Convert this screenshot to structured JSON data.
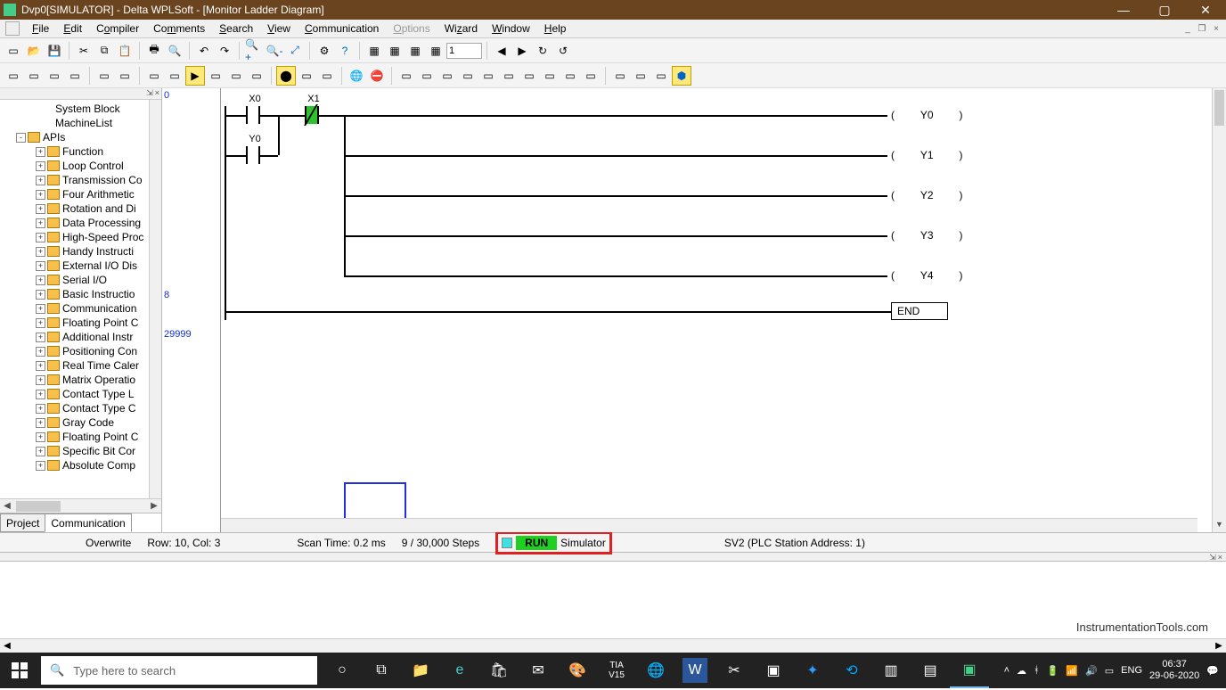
{
  "window": {
    "title": "Dvp0[SIMULATOR]  - Delta WPLSoft - [Monitor Ladder Diagram]",
    "btn_min": "—",
    "btn_max": "▢",
    "btn_close": "✕"
  },
  "menu": {
    "file": "File",
    "edit": "Edit",
    "compiler": "Compiler",
    "comments": "Comments",
    "search": "Search",
    "view": "View",
    "communication": "Communication",
    "options": "Options",
    "wizard": "Wizard",
    "window": "Window",
    "help": "Help"
  },
  "mdi": {
    "min": "_",
    "restore": "❐",
    "close": "×"
  },
  "toolbar1": {
    "field_value": "1"
  },
  "gutter": {
    "n0": "0",
    "n1": "8",
    "n2": "29999"
  },
  "ladder": {
    "c0": "X0",
    "c1": "X1",
    "c2": "Y0",
    "out0": "Y0",
    "out1": "Y1",
    "out2": "Y2",
    "out3": "Y3",
    "out4": "Y4",
    "end": "END"
  },
  "tree": {
    "system_block": "System Block",
    "machinelist": "MachineList",
    "apis": "APIs",
    "items": [
      "Function",
      "Loop Control",
      "Transmission Co",
      "Four Arithmetic",
      "Rotation and Di",
      "Data Processing",
      "High-Speed Proc",
      "Handy Instructi",
      "External I/O Dis",
      "Serial I/O",
      "Basic Instructio",
      "Communication",
      "Floating Point C",
      "Additional Instr",
      "Positioning Con",
      "Real Time Caler",
      "Matrix Operatio",
      "Contact Type L",
      "Contact Type C",
      "Gray Code",
      "Floating Point C",
      "Specific Bit Cor",
      "Absolute Comp"
    ],
    "tab_project": "Project",
    "tab_comm": "Communication"
  },
  "status": {
    "overwrite": "Overwrite",
    "rowcol": "Row: 10, Col: 3",
    "scantime": "Scan Time: 0.2 ms",
    "steps": "9 / 30,000 Steps",
    "run": "RUN",
    "simulator": "Simulator",
    "plc": "SV2 (PLC Station Address: 1)"
  },
  "watermark": "InstrumentationTools.com",
  "taskbar": {
    "search_placeholder": "Type here to search",
    "time": "06:37",
    "date": "29-06-2020",
    "lang": "ENG"
  }
}
